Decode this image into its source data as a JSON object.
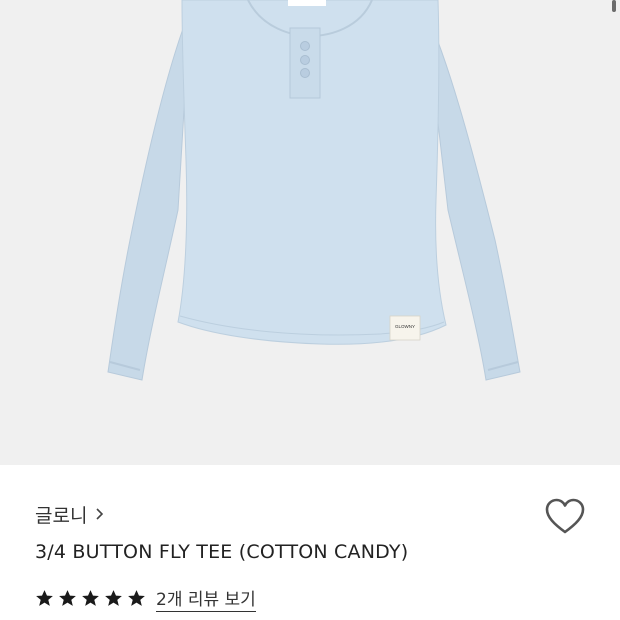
{
  "product": {
    "brand": "글로니",
    "title": "3/4 BUTTON FLY TEE (COTTON CANDY)",
    "tag_text": "GLOWNY",
    "garment_color": "#cfe0ee",
    "image_background": "#f0f0f0",
    "rating": 5,
    "rating_max": 5,
    "review_link": "2개 리뷰 보기"
  },
  "icons": {
    "brand_chevron": "chevron-right-icon",
    "wishlist": "heart-outline-icon",
    "star": "star-filled-icon"
  },
  "colors": {
    "text_primary": "#222222",
    "star": "#1a1a1a",
    "heart_stroke": "#555555"
  }
}
